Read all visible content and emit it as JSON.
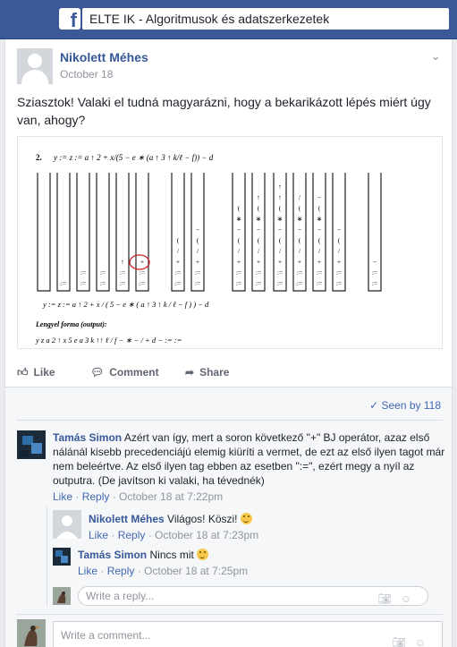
{
  "header": {
    "group_name": "ELTE IK - Algoritmusok és adatszerkezetek"
  },
  "post": {
    "author": "Nikolett Méhes",
    "date": "October 18",
    "text": "Sziasztok! Valaki el tudná magyarázni, hogy a bekarikázott lépés miért úgy van, ahogy?",
    "image": {
      "number": "2.",
      "expression": "y := z := a ↑ 2 + x/(5 − e ∗ (a ↑ 3 ↑ k/ℓ − f)) − d",
      "token_row": "y  :=  z  :=  a  ↑  2  +  x  /  (  5  −  e  ∗  (  a  ↑  3  ↑  k  /  ℓ  −  f  )  )  −  d",
      "output_title": "Lengyel forma (output):",
      "output": "y z a 2 ↑ x 5 e a 3 k ↑↑ ℓ / f − ∗ − / + d − := :="
    },
    "actions": {
      "like": "Like",
      "comment": "Comment",
      "share": "Share"
    },
    "seen_by": "Seen by 118"
  },
  "comments": [
    {
      "author": "Tamás Simon",
      "text": "Azért van így, mert a soron következő \"+\" BJ operátor, azaz első nálánál kisebb precedenciájú elemig kiüríti a vermet, de ezt az első ilyen tagot már nem beleértve. Az első ilyen tag ebben az esetben \":=\", ezért megy a nyíl az outputra. (De javítson ki valaki, ha tévednék)",
      "like": "Like",
      "reply": "Reply",
      "time": "October 18 at 7:22pm"
    },
    {
      "author": "Nikolett Méhes",
      "text": "Világos! Köszi!",
      "like": "Like",
      "reply": "Reply",
      "time": "October 18 at 7:23pm"
    },
    {
      "author": "Tamás Simon",
      "text": "Nincs mit",
      "like": "Like",
      "reply": "Reply",
      "time": "October 18 at 7:25pm"
    }
  ],
  "reply_box": {
    "placeholder": "Write a reply..."
  },
  "comment_box": {
    "placeholder": "Write a comment..."
  },
  "colors": {
    "facebook_blue": "#3b5998",
    "link_blue": "#365899",
    "circle_red": "#cc2222"
  },
  "icons": [
    "facebook-logo-icon",
    "chevron-down-icon",
    "like-icon",
    "comment-icon",
    "share-icon",
    "check-icon",
    "camera-icon",
    "smiley-icon"
  ]
}
